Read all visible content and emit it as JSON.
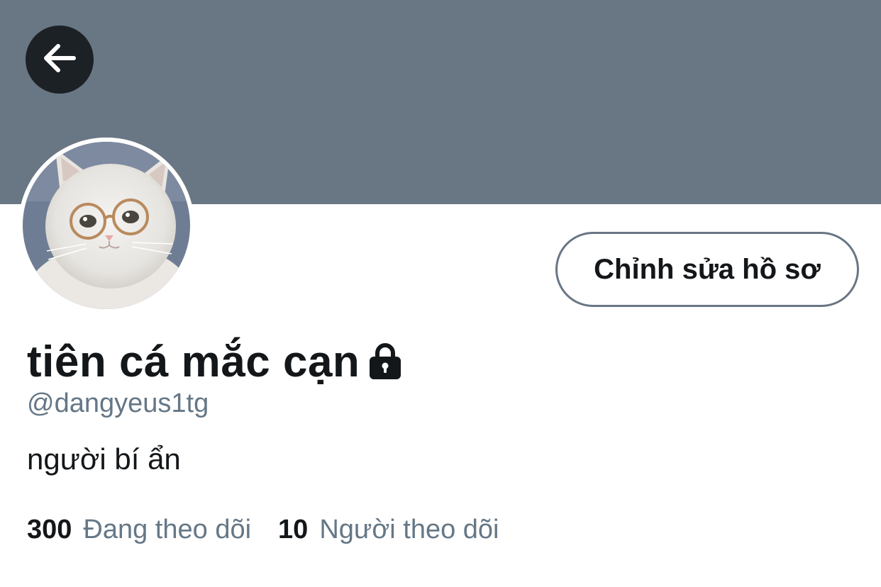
{
  "header": {
    "back_icon": "arrow-left-icon",
    "banner_color": "#697684"
  },
  "profile": {
    "avatar_description_icon": "avatar",
    "edit_button_label": "Chỉnh sửa hồ sơ",
    "display_name": "tiên cá mắc cạn",
    "protected_icon": "lock-icon",
    "handle": "@dangyeus1tg",
    "bio": "người bí ẩn"
  },
  "stats": {
    "following_count": "300",
    "following_label": "Đang theo dõi",
    "followers_count": "10",
    "followers_label": "Người theo dõi"
  },
  "colors": {
    "primary_text": "#14171a",
    "secondary_text": "#657786",
    "border": "#697684"
  }
}
